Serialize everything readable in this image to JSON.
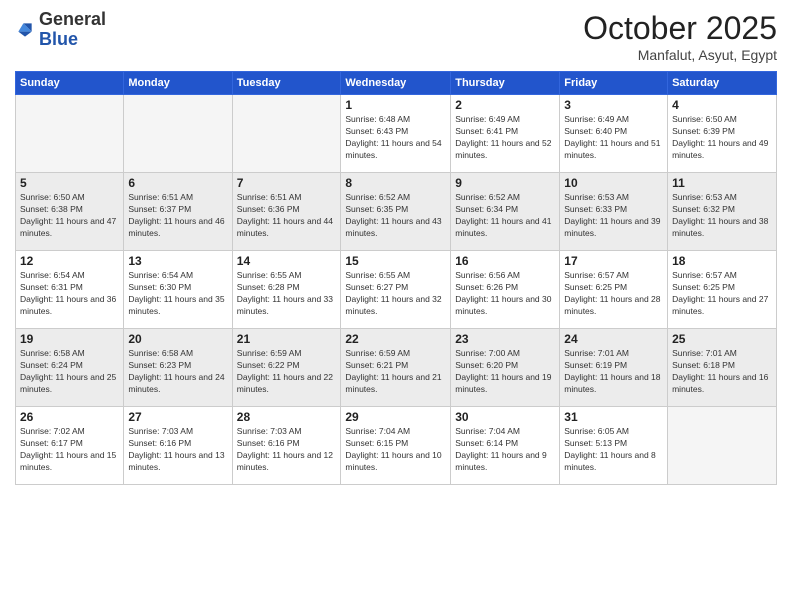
{
  "header": {
    "logo_general": "General",
    "logo_blue": "Blue",
    "month": "October 2025",
    "location": "Manfalut, Asyut, Egypt"
  },
  "days_of_week": [
    "Sunday",
    "Monday",
    "Tuesday",
    "Wednesday",
    "Thursday",
    "Friday",
    "Saturday"
  ],
  "weeks": [
    [
      {
        "day": "",
        "sunrise": "",
        "sunset": "",
        "daylight": ""
      },
      {
        "day": "",
        "sunrise": "",
        "sunset": "",
        "daylight": ""
      },
      {
        "day": "",
        "sunrise": "",
        "sunset": "",
        "daylight": ""
      },
      {
        "day": "1",
        "sunrise": "Sunrise: 6:48 AM",
        "sunset": "Sunset: 6:43 PM",
        "daylight": "Daylight: 11 hours and 54 minutes."
      },
      {
        "day": "2",
        "sunrise": "Sunrise: 6:49 AM",
        "sunset": "Sunset: 6:41 PM",
        "daylight": "Daylight: 11 hours and 52 minutes."
      },
      {
        "day": "3",
        "sunrise": "Sunrise: 6:49 AM",
        "sunset": "Sunset: 6:40 PM",
        "daylight": "Daylight: 11 hours and 51 minutes."
      },
      {
        "day": "4",
        "sunrise": "Sunrise: 6:50 AM",
        "sunset": "Sunset: 6:39 PM",
        "daylight": "Daylight: 11 hours and 49 minutes."
      }
    ],
    [
      {
        "day": "5",
        "sunrise": "Sunrise: 6:50 AM",
        "sunset": "Sunset: 6:38 PM",
        "daylight": "Daylight: 11 hours and 47 minutes."
      },
      {
        "day": "6",
        "sunrise": "Sunrise: 6:51 AM",
        "sunset": "Sunset: 6:37 PM",
        "daylight": "Daylight: 11 hours and 46 minutes."
      },
      {
        "day": "7",
        "sunrise": "Sunrise: 6:51 AM",
        "sunset": "Sunset: 6:36 PM",
        "daylight": "Daylight: 11 hours and 44 minutes."
      },
      {
        "day": "8",
        "sunrise": "Sunrise: 6:52 AM",
        "sunset": "Sunset: 6:35 PM",
        "daylight": "Daylight: 11 hours and 43 minutes."
      },
      {
        "day": "9",
        "sunrise": "Sunrise: 6:52 AM",
        "sunset": "Sunset: 6:34 PM",
        "daylight": "Daylight: 11 hours and 41 minutes."
      },
      {
        "day": "10",
        "sunrise": "Sunrise: 6:53 AM",
        "sunset": "Sunset: 6:33 PM",
        "daylight": "Daylight: 11 hours and 39 minutes."
      },
      {
        "day": "11",
        "sunrise": "Sunrise: 6:53 AM",
        "sunset": "Sunset: 6:32 PM",
        "daylight": "Daylight: 11 hours and 38 minutes."
      }
    ],
    [
      {
        "day": "12",
        "sunrise": "Sunrise: 6:54 AM",
        "sunset": "Sunset: 6:31 PM",
        "daylight": "Daylight: 11 hours and 36 minutes."
      },
      {
        "day": "13",
        "sunrise": "Sunrise: 6:54 AM",
        "sunset": "Sunset: 6:30 PM",
        "daylight": "Daylight: 11 hours and 35 minutes."
      },
      {
        "day": "14",
        "sunrise": "Sunrise: 6:55 AM",
        "sunset": "Sunset: 6:28 PM",
        "daylight": "Daylight: 11 hours and 33 minutes."
      },
      {
        "day": "15",
        "sunrise": "Sunrise: 6:55 AM",
        "sunset": "Sunset: 6:27 PM",
        "daylight": "Daylight: 11 hours and 32 minutes."
      },
      {
        "day": "16",
        "sunrise": "Sunrise: 6:56 AM",
        "sunset": "Sunset: 6:26 PM",
        "daylight": "Daylight: 11 hours and 30 minutes."
      },
      {
        "day": "17",
        "sunrise": "Sunrise: 6:57 AM",
        "sunset": "Sunset: 6:25 PM",
        "daylight": "Daylight: 11 hours and 28 minutes."
      },
      {
        "day": "18",
        "sunrise": "Sunrise: 6:57 AM",
        "sunset": "Sunset: 6:25 PM",
        "daylight": "Daylight: 11 hours and 27 minutes."
      }
    ],
    [
      {
        "day": "19",
        "sunrise": "Sunrise: 6:58 AM",
        "sunset": "Sunset: 6:24 PM",
        "daylight": "Daylight: 11 hours and 25 minutes."
      },
      {
        "day": "20",
        "sunrise": "Sunrise: 6:58 AM",
        "sunset": "Sunset: 6:23 PM",
        "daylight": "Daylight: 11 hours and 24 minutes."
      },
      {
        "day": "21",
        "sunrise": "Sunrise: 6:59 AM",
        "sunset": "Sunset: 6:22 PM",
        "daylight": "Daylight: 11 hours and 22 minutes."
      },
      {
        "day": "22",
        "sunrise": "Sunrise: 6:59 AM",
        "sunset": "Sunset: 6:21 PM",
        "daylight": "Daylight: 11 hours and 21 minutes."
      },
      {
        "day": "23",
        "sunrise": "Sunrise: 7:00 AM",
        "sunset": "Sunset: 6:20 PM",
        "daylight": "Daylight: 11 hours and 19 minutes."
      },
      {
        "day": "24",
        "sunrise": "Sunrise: 7:01 AM",
        "sunset": "Sunset: 6:19 PM",
        "daylight": "Daylight: 11 hours and 18 minutes."
      },
      {
        "day": "25",
        "sunrise": "Sunrise: 7:01 AM",
        "sunset": "Sunset: 6:18 PM",
        "daylight": "Daylight: 11 hours and 16 minutes."
      }
    ],
    [
      {
        "day": "26",
        "sunrise": "Sunrise: 7:02 AM",
        "sunset": "Sunset: 6:17 PM",
        "daylight": "Daylight: 11 hours and 15 minutes."
      },
      {
        "day": "27",
        "sunrise": "Sunrise: 7:03 AM",
        "sunset": "Sunset: 6:16 PM",
        "daylight": "Daylight: 11 hours and 13 minutes."
      },
      {
        "day": "28",
        "sunrise": "Sunrise: 7:03 AM",
        "sunset": "Sunset: 6:16 PM",
        "daylight": "Daylight: 11 hours and 12 minutes."
      },
      {
        "day": "29",
        "sunrise": "Sunrise: 7:04 AM",
        "sunset": "Sunset: 6:15 PM",
        "daylight": "Daylight: 11 hours and 10 minutes."
      },
      {
        "day": "30",
        "sunrise": "Sunrise: 7:04 AM",
        "sunset": "Sunset: 6:14 PM",
        "daylight": "Daylight: 11 hours and 9 minutes."
      },
      {
        "day": "31",
        "sunrise": "Sunrise: 6:05 AM",
        "sunset": "Sunset: 5:13 PM",
        "daylight": "Daylight: 11 hours and 8 minutes."
      },
      {
        "day": "",
        "sunrise": "",
        "sunset": "",
        "daylight": ""
      }
    ]
  ]
}
